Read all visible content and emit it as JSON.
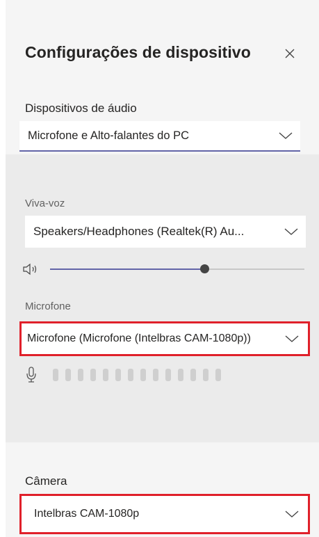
{
  "dialog": {
    "title": "Configurações de dispositivo",
    "close_icon": "close-icon"
  },
  "audio": {
    "label": "Dispositivos de áudio",
    "selected": "Microfone e Alto-falantes do PC"
  },
  "speaker": {
    "label": "Viva-voz",
    "selected": "Speakers/Headphones (Realtek(R) Au...",
    "volume_percent": 61
  },
  "microphone": {
    "label": "Microfone",
    "selected": "Microfone (Microfone (Intelbras CAM-1080p))",
    "level_bars": 14
  },
  "camera": {
    "label": "Câmera",
    "selected": "Intelbras CAM-1080p"
  },
  "colors": {
    "accent": "#6264a7",
    "highlight_border": "#e0202a",
    "panel_bg": "#f5f5f5"
  }
}
